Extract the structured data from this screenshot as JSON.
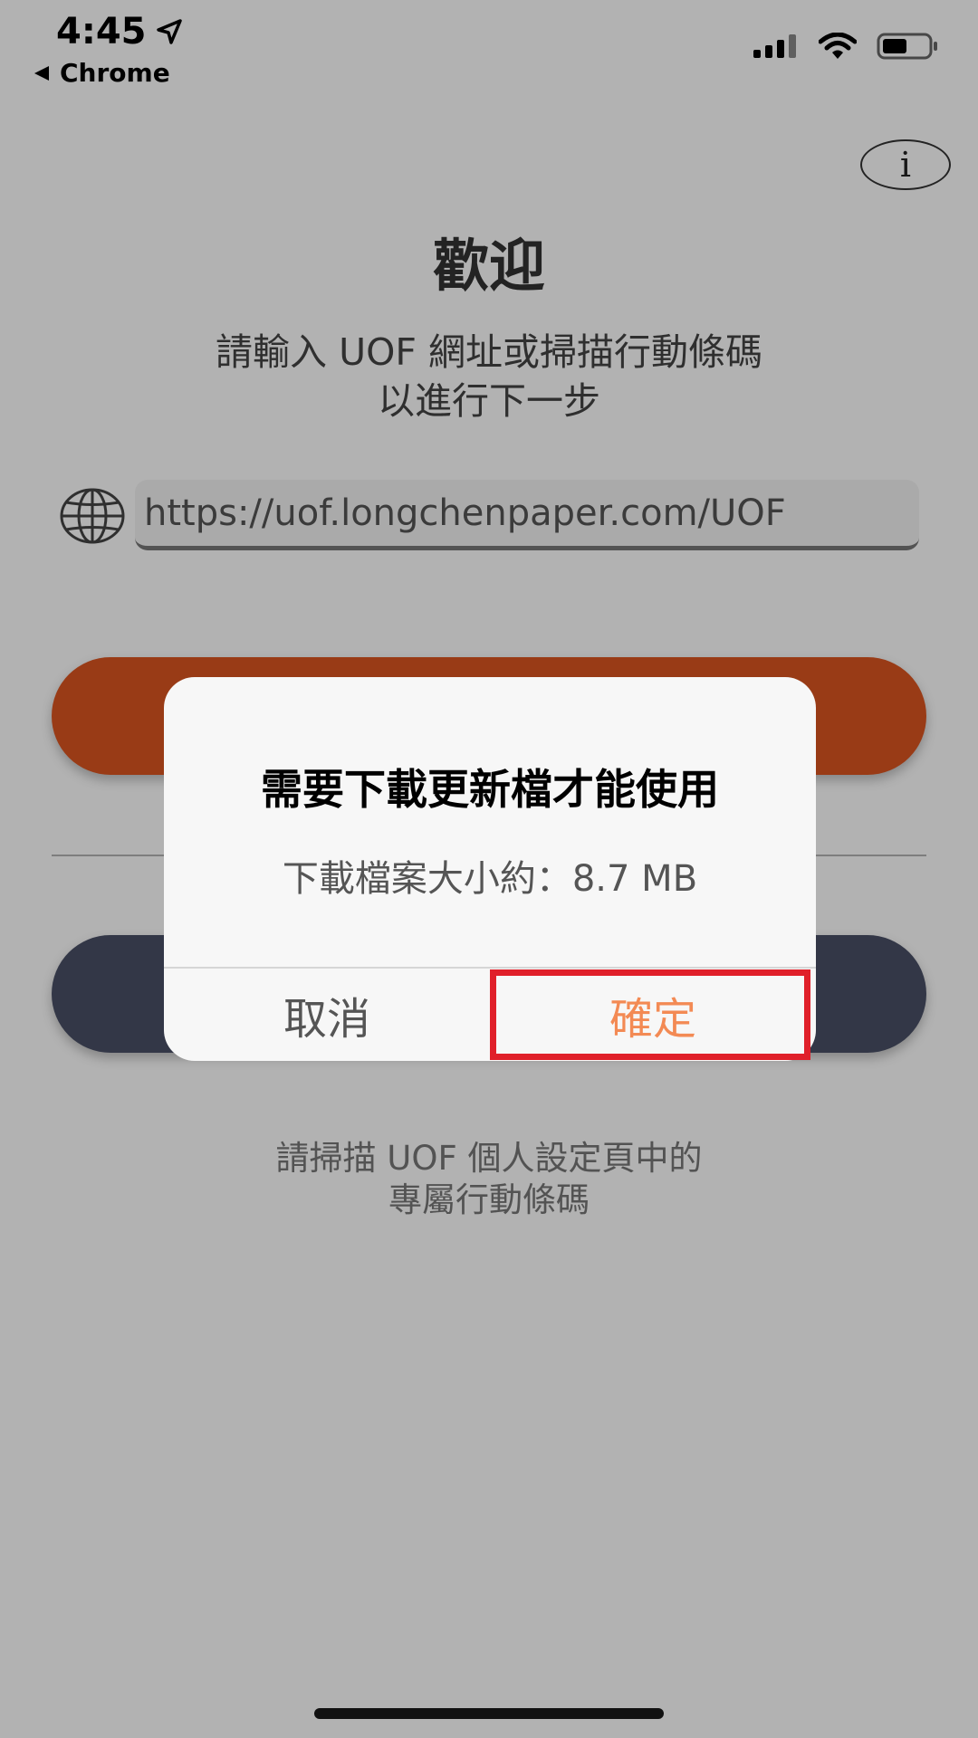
{
  "status_bar": {
    "time": "4:45",
    "back_app": "Chrome"
  },
  "welcome": {
    "title": "歡迎",
    "subtitle_line1": "請輸入 UOF 網址或掃描行動條碼",
    "subtitle_line2": "以進行下一步"
  },
  "url_field": {
    "value": "https://uof.longchenpaper.com/UOF"
  },
  "scan_hint": {
    "line1": "請掃描 UOF 個人設定頁中的",
    "line2": "專屬行動條碼"
  },
  "alert": {
    "title": "需要下載更新檔才能使用",
    "message": "下載檔案大小約：8.7 MB",
    "cancel_label": "取消",
    "confirm_label": "確定"
  },
  "colors": {
    "primary_button": "#dc5520",
    "scan_button": "#4a5066",
    "confirm_text": "#f38a54",
    "highlight": "#e0202a"
  },
  "icons": {
    "location": "location-arrow-icon",
    "back": "back-triangle-icon",
    "signal": "signal-icon",
    "wifi": "wifi-icon",
    "battery": "battery-icon",
    "info": "info-icon",
    "globe": "globe-icon"
  }
}
